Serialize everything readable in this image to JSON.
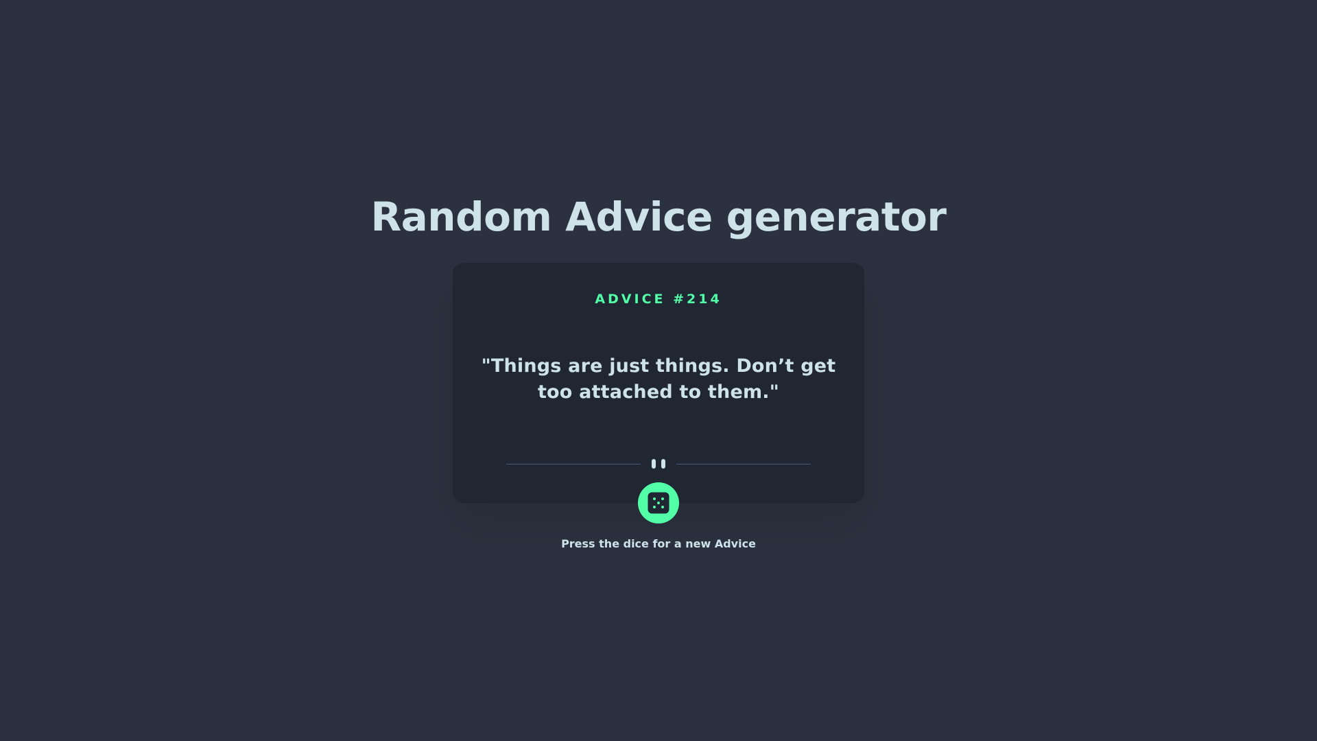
{
  "page": {
    "title": "Random Advice generator",
    "hint": "Press the dice for a new Advice"
  },
  "card": {
    "advice_label": "ADVICE #214",
    "advice_text": "\"Things are just things. Don’t get too attached to them.\""
  },
  "icons": {
    "divider": "pause-icon",
    "dice": "dice-icon"
  },
  "colors": {
    "background": "#2b313e",
    "card": "#202632",
    "accent": "#52ffa8",
    "text": "#cee3e9",
    "divider": "#4f5d74"
  }
}
